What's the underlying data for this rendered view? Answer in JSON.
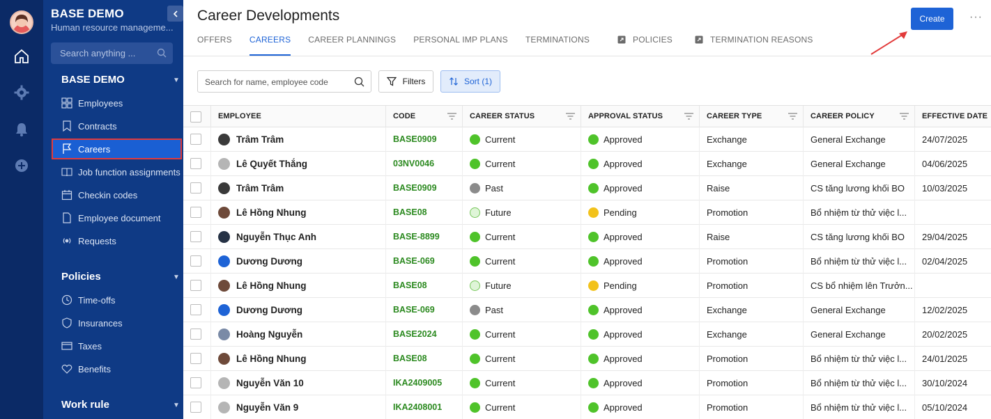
{
  "sidebar": {
    "brand_title": "BASE DEMO",
    "brand_subtitle": "Human resource manageme...",
    "search_placeholder": "Search anything ...",
    "sections": [
      {
        "title": "BASE DEMO",
        "items": [
          {
            "label": "Employees",
            "icon": "grid-icon"
          },
          {
            "label": "Contracts",
            "icon": "bookmark-icon"
          },
          {
            "label": "Careers",
            "icon": "flag-icon",
            "active": true
          },
          {
            "label": "Job function assignments",
            "icon": "book-icon"
          },
          {
            "label": "Checkin codes",
            "icon": "calendar-icon"
          },
          {
            "label": "Employee document",
            "icon": "document-icon"
          },
          {
            "label": "Requests",
            "icon": "broadcast-icon"
          }
        ]
      },
      {
        "title": "Policies",
        "items": [
          {
            "label": "Time-offs",
            "icon": "clock-icon"
          },
          {
            "label": "Insurances",
            "icon": "shield-icon"
          },
          {
            "label": "Taxes",
            "icon": "card-icon"
          },
          {
            "label": "Benefits",
            "icon": "heart-icon"
          }
        ]
      },
      {
        "title": "Work rule",
        "items": []
      }
    ]
  },
  "header": {
    "title": "Career Developments",
    "create_label": "Create",
    "more_label": "···",
    "tabs": [
      {
        "label": "OFFERS"
      },
      {
        "label": "CAREERS",
        "active": true
      },
      {
        "label": "CAREER PLANNINGS"
      },
      {
        "label": "PERSONAL IMP PLANS"
      },
      {
        "label": "TERMINATIONS"
      },
      {
        "label": "POLICIES",
        "icon": "external-link-icon"
      },
      {
        "label": "TERMINATION REASONS",
        "icon": "external-link-icon"
      }
    ]
  },
  "toolbar": {
    "search_placeholder": "Search for name, employee code",
    "filters_label": "Filters",
    "sort_label": "Sort (1)"
  },
  "table": {
    "columns": [
      "EMPLOYEE",
      "CODE",
      "CAREER STATUS",
      "APPROVAL STATUS",
      "CAREER TYPE",
      "CAREER POLICY",
      "EFFECTIVE DATE"
    ],
    "rows": [
      {
        "employee": "Trâm Trâm",
        "avatar": "#3a3a3a",
        "code": "BASE0909",
        "career_status": "Current",
        "career_dot": "green",
        "approval": "Approved",
        "approval_dot": "green",
        "type": "Exchange",
        "policy": "General Exchange",
        "date": "24/07/2025"
      },
      {
        "employee": "Lê Quyết Thắng",
        "avatar": "#b5b5b5",
        "code": "03NV0046",
        "career_status": "Current",
        "career_dot": "green",
        "approval": "Approved",
        "approval_dot": "green",
        "type": "Exchange",
        "policy": "General Exchange",
        "date": "04/06/2025"
      },
      {
        "employee": "Trâm Trâm",
        "avatar": "#3a3a3a",
        "code": "BASE0909",
        "career_status": "Past",
        "career_dot": "gray",
        "approval": "Approved",
        "approval_dot": "green",
        "type": "Raise",
        "policy": "CS tăng lương khối BO",
        "date": "10/03/2025"
      },
      {
        "employee": "Lê Hồng Nhung",
        "avatar": "#6e4a3a",
        "code": "BASE08",
        "career_status": "Future",
        "career_dot": "future",
        "approval": "Pending",
        "approval_dot": "yellow",
        "type": "Promotion",
        "policy": "Bổ nhiệm từ thử việc l...",
        "date": ""
      },
      {
        "employee": "Nguyễn Thục Anh",
        "avatar": "#263245",
        "code": "BASE-8899",
        "career_status": "Current",
        "career_dot": "green",
        "approval": "Approved",
        "approval_dot": "green",
        "type": "Raise",
        "policy": "CS tăng lương khối BO",
        "date": "29/04/2025"
      },
      {
        "employee": "Dương Dương",
        "avatar": "#1e63d6",
        "code": "BASE-069",
        "career_status": "Current",
        "career_dot": "green",
        "approval": "Approved",
        "approval_dot": "green",
        "type": "Promotion",
        "policy": "Bổ nhiệm từ thử việc l...",
        "date": "02/04/2025"
      },
      {
        "employee": "Lê Hồng Nhung",
        "avatar": "#6e4a3a",
        "code": "BASE08",
        "career_status": "Future",
        "career_dot": "future",
        "approval": "Pending",
        "approval_dot": "yellow",
        "type": "Promotion",
        "policy": "CS bổ nhiệm lên Trưởn...",
        "date": ""
      },
      {
        "employee": "Dương Dương",
        "avatar": "#1e63d6",
        "code": "BASE-069",
        "career_status": "Past",
        "career_dot": "gray",
        "approval": "Approved",
        "approval_dot": "green",
        "type": "Exchange",
        "policy": "General Exchange",
        "date": "12/02/2025"
      },
      {
        "employee": "Hoàng Nguyễn",
        "avatar": "#7a8aa6",
        "code": "BASE2024",
        "career_status": "Current",
        "career_dot": "green",
        "approval": "Approved",
        "approval_dot": "green",
        "type": "Exchange",
        "policy": "General Exchange",
        "date": "20/02/2025"
      },
      {
        "employee": "Lê Hồng Nhung",
        "avatar": "#6e4a3a",
        "code": "BASE08",
        "career_status": "Current",
        "career_dot": "green",
        "approval": "Approved",
        "approval_dot": "green",
        "type": "Promotion",
        "policy": "Bổ nhiệm từ thử việc l...",
        "date": "24/01/2025"
      },
      {
        "employee": "Nguyễn Văn 10",
        "avatar": "#b5b5b5",
        "code": "IKA2409005",
        "career_status": "Current",
        "career_dot": "green",
        "approval": "Approved",
        "approval_dot": "green",
        "type": "Promotion",
        "policy": "Bổ nhiệm từ thử việc l...",
        "date": "30/10/2024"
      },
      {
        "employee": "Nguyễn Văn 9",
        "avatar": "#b5b5b5",
        "code": "IKA2408001",
        "career_status": "Current",
        "career_dot": "green",
        "approval": "Approved",
        "approval_dot": "green",
        "type": "Promotion",
        "policy": "Bổ nhiệm từ thử việc l...",
        "date": "05/10/2024"
      }
    ]
  },
  "colors": {
    "sidebar_bg": "#0f3a85",
    "rail_bg": "#0b2a66",
    "accent": "#1e63d6",
    "code_green": "#2c8a20",
    "status_green": "#4fc32a",
    "status_gray": "#8b8b8b",
    "status_yellow": "#f2c21b",
    "highlight_red": "#e23a3a"
  }
}
